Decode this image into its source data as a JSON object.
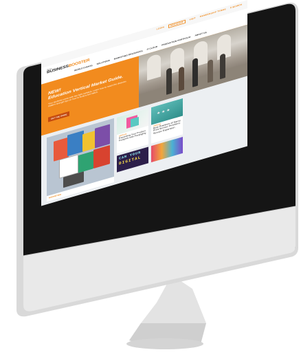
{
  "top_links": [
    {
      "label": "LOGIN",
      "boxed": false
    },
    {
      "label": "REGISTER",
      "boxed": true
    },
    {
      "label": "VISIT",
      "boxed": false
    },
    {
      "label": "MEMBERSHIP TERMS",
      "boxed": false
    }
  ],
  "search_label": "SEARCH",
  "logo": {
    "small": "Xerox",
    "main_a": "BUSINESS",
    "main_b": "BOOSTER"
  },
  "nav": [
    "WORLD EVENTS",
    "SOLUTIONS",
    "MARKETING RESOURCES",
    "IT CLOUD",
    "PRODUCTION PORTFOLIO",
    "ABOUT US"
  ],
  "hero": {
    "new_label": "NEW!",
    "headline": "Education Vertical Market Guide.",
    "subtext": "Your students come with the right contacts. Learn how to reach the decision makers and get tips on how to build a bid match.",
    "cta_label": "GET THE GUIDE"
  },
  "tiles": {
    "main_tag": "MARKETING",
    "packaging": {
      "tag": "ARTICLE",
      "title": "Expanding Your Product Footprint with Packaging"
    },
    "best_practices": {
      "tag": "ARTICLE",
      "title": "Best Practices of Savvy Print Service Providers: Service Expansion"
    },
    "can_you": {
      "line1": "CAN YOUR",
      "line2": "DIGITAL"
    }
  },
  "colors": {
    "accent": "#f28b1e",
    "cta": "#c44a10",
    "teal": "#4fb3b0"
  }
}
